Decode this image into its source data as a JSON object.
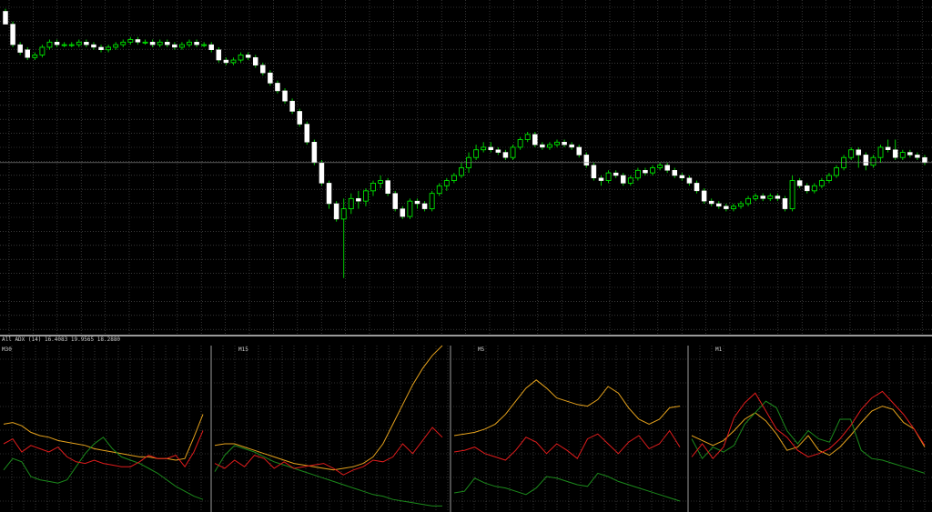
{
  "indicator_header": "All ADX (14) 16.4083 19.9565 18.2880",
  "colors": {
    "background": "#000000",
    "grid": "#5a5a5a",
    "candle_bull_body": "#000000",
    "candle_bull_outline": "#00ff00",
    "candle_bear_body": "#ffffff",
    "wick": "#00c800",
    "separator": "#9a9a9a",
    "adx_line": "#e6a21c",
    "plus_di_line": "#1c8a1c",
    "minus_di_line": "#e01c1c"
  },
  "chart_data": [
    {
      "type": "candlestick",
      "title": "",
      "price_axis": "none",
      "grid": true,
      "ylim": [
        0,
        100
      ],
      "candles": [
        [
          97,
          92,
          98,
          92
        ],
        [
          92,
          84,
          93,
          83
        ],
        [
          84,
          81,
          85,
          80
        ],
        [
          82,
          79,
          83,
          78
        ],
        [
          79,
          80,
          81,
          78
        ],
        [
          80,
          83,
          84,
          79
        ],
        [
          83,
          85,
          86,
          82
        ],
        [
          85,
          84,
          86,
          83
        ],
        [
          84,
          84,
          85,
          83
        ],
        [
          84,
          84,
          85,
          83
        ],
        [
          84,
          85,
          86,
          83
        ],
        [
          85,
          84,
          86,
          83
        ],
        [
          84,
          83,
          85,
          82
        ],
        [
          83,
          82,
          84,
          81
        ],
        [
          82,
          83,
          84,
          81
        ],
        [
          83,
          84,
          85,
          82
        ],
        [
          84,
          85,
          86,
          83
        ],
        [
          85,
          86,
          87,
          84
        ],
        [
          86,
          85,
          87,
          84
        ],
        [
          85,
          85,
          86,
          84
        ],
        [
          85,
          84,
          86,
          83
        ],
        [
          84,
          85,
          86,
          83
        ],
        [
          85,
          84,
          86,
          83
        ],
        [
          84,
          83,
          85,
          82
        ],
        [
          83,
          84,
          85,
          82
        ],
        [
          84,
          85,
          86,
          83
        ],
        [
          85,
          84,
          86,
          83
        ],
        [
          84,
          84,
          85,
          83
        ],
        [
          84,
          82,
          85,
          81
        ],
        [
          82,
          78,
          83,
          77
        ],
        [
          78,
          77,
          79,
          76
        ],
        [
          77,
          78,
          79,
          76
        ],
        [
          78,
          80,
          81,
          77
        ],
        [
          80,
          79,
          81,
          78
        ],
        [
          79,
          76,
          80,
          75
        ],
        [
          76,
          73,
          77,
          72
        ],
        [
          73,
          69,
          74,
          68
        ],
        [
          69,
          66,
          70,
          65
        ],
        [
          66,
          62,
          67,
          61
        ],
        [
          62,
          58,
          63,
          57
        ],
        [
          58,
          53,
          59,
          52
        ],
        [
          53,
          46,
          54,
          45
        ],
        [
          46,
          38,
          47,
          37
        ],
        [
          38,
          30,
          39,
          29
        ],
        [
          30,
          22,
          31,
          20
        ],
        [
          22,
          16,
          23,
          15
        ],
        [
          16,
          20,
          24,
          -7
        ],
        [
          20,
          24,
          26,
          18
        ],
        [
          24,
          23,
          27,
          20
        ],
        [
          23,
          27,
          28,
          21
        ],
        [
          27,
          30,
          31,
          25
        ],
        [
          30,
          31,
          33,
          28
        ],
        [
          31,
          26,
          32,
          25
        ],
        [
          26,
          20,
          27,
          19
        ],
        [
          20,
          17,
          21,
          16
        ],
        [
          17,
          23,
          24,
          16
        ],
        [
          23,
          22,
          24,
          20
        ],
        [
          22,
          20,
          23,
          19
        ],
        [
          20,
          26,
          27,
          19
        ],
        [
          26,
          29,
          30,
          25
        ],
        [
          29,
          31,
          32,
          27
        ],
        [
          31,
          33,
          34,
          30
        ],
        [
          33,
          36,
          38,
          32
        ],
        [
          36,
          40,
          42,
          34
        ],
        [
          40,
          43,
          45,
          39
        ],
        [
          43,
          44,
          46,
          42
        ],
        [
          44,
          43,
          46,
          42
        ],
        [
          43,
          42,
          44,
          41
        ],
        [
          42,
          40,
          43,
          39
        ],
        [
          40,
          44,
          45,
          39
        ],
        [
          44,
          47,
          48,
          43
        ],
        [
          47,
          49,
          50,
          46
        ],
        [
          49,
          45,
          50,
          44
        ],
        [
          45,
          44,
          46,
          43
        ],
        [
          44,
          45,
          46,
          43
        ],
        [
          45,
          46,
          47,
          44
        ],
        [
          46,
          45,
          47,
          44
        ],
        [
          45,
          44,
          46,
          43
        ],
        [
          44,
          41,
          45,
          40
        ],
        [
          41,
          37,
          42,
          36
        ],
        [
          37,
          32,
          38,
          31
        ],
        [
          32,
          31,
          33,
          29
        ],
        [
          31,
          34,
          35,
          30
        ],
        [
          34,
          33,
          35,
          32
        ],
        [
          33,
          30,
          34,
          29
        ],
        [
          30,
          32,
          33,
          29
        ],
        [
          32,
          35,
          36,
          31
        ],
        [
          35,
          34,
          36,
          33
        ],
        [
          34,
          36,
          37,
          33
        ],
        [
          36,
          37,
          38,
          35
        ],
        [
          37,
          35,
          38,
          34
        ],
        [
          35,
          33,
          36,
          32
        ],
        [
          33,
          32,
          34,
          31
        ],
        [
          32,
          30,
          33,
          29
        ],
        [
          30,
          27,
          31,
          26
        ],
        [
          27,
          23,
          28,
          22
        ],
        [
          23,
          22,
          24,
          21
        ],
        [
          22,
          21,
          23,
          20
        ],
        [
          21,
          20,
          22,
          19
        ],
        [
          20,
          21,
          22,
          19
        ],
        [
          21,
          22,
          23,
          20
        ],
        [
          22,
          24,
          25,
          21
        ],
        [
          24,
          25,
          26,
          23
        ],
        [
          25,
          24,
          26,
          23
        ],
        [
          24,
          25,
          26,
          23
        ],
        [
          25,
          24,
          26,
          23
        ],
        [
          24,
          20,
          25,
          19
        ],
        [
          20,
          31,
          33,
          19
        ],
        [
          31,
          29,
          32,
          28
        ],
        [
          29,
          27,
          30,
          26
        ],
        [
          27,
          29,
          30,
          26
        ],
        [
          29,
          31,
          32,
          28
        ],
        [
          31,
          33,
          34,
          30
        ],
        [
          33,
          36,
          37,
          32
        ],
        [
          36,
          40,
          41,
          35
        ],
        [
          40,
          43,
          44,
          39
        ],
        [
          43,
          41,
          44,
          36
        ],
        [
          41,
          37,
          42,
          35
        ],
        [
          37,
          40,
          41,
          36
        ],
        [
          40,
          44,
          45,
          38
        ],
        [
          44,
          43,
          47,
          42
        ],
        [
          43,
          40,
          47,
          39
        ],
        [
          40,
          42,
          43,
          39
        ],
        [
          42,
          41,
          43,
          40
        ],
        [
          41,
          40,
          42,
          39
        ],
        [
          40,
          38,
          41,
          37
        ]
      ]
    },
    {
      "type": "line",
      "title": "M30",
      "grid": true,
      "ylim": [
        0,
        100
      ],
      "series": [
        {
          "key": "adx",
          "values": [
            52,
            53,
            51,
            47,
            45,
            44,
            42,
            41,
            40,
            39,
            37,
            36,
            35,
            34,
            33,
            32,
            32,
            31,
            31,
            30,
            31,
            44,
            58
          ]
        },
        {
          "key": "plus_di",
          "values": [
            24,
            31,
            29,
            20,
            18,
            17,
            16,
            18,
            26,
            34,
            40,
            44,
            37,
            32,
            30,
            28,
            25,
            22,
            18,
            14,
            11,
            8,
            6
          ]
        },
        {
          "key": "minus_di",
          "values": [
            40,
            43,
            35,
            39,
            37,
            35,
            38,
            32,
            29,
            28,
            30,
            28,
            27,
            26,
            26,
            29,
            33,
            31,
            31,
            33,
            26,
            35,
            48
          ]
        }
      ]
    },
    {
      "type": "line",
      "title": "M15",
      "grid": true,
      "ylim": [
        0,
        100
      ],
      "series": [
        {
          "key": "adx",
          "values": [
            39,
            40,
            40,
            38,
            36,
            34,
            32,
            30,
            28,
            27,
            26,
            25,
            24,
            25,
            26,
            28,
            32,
            40,
            52,
            64,
            76,
            86,
            94,
            100
          ]
        },
        {
          "key": "plus_di",
          "values": [
            23,
            33,
            39,
            37,
            35,
            32,
            29,
            27,
            25,
            23,
            21,
            19,
            17,
            15,
            13,
            11,
            9,
            8,
            6,
            5,
            4,
            3,
            2,
            2
          ]
        },
        {
          "key": "minus_di",
          "values": [
            28,
            25,
            30,
            26,
            33,
            31,
            25,
            29,
            25,
            26,
            27,
            28,
            25,
            21,
            24,
            26,
            30,
            29,
            32,
            40,
            34,
            42,
            50,
            44
          ]
        }
      ]
    },
    {
      "type": "line",
      "title": "M5",
      "grid": true,
      "ylim": [
        0,
        100
      ],
      "series": [
        {
          "key": "adx",
          "values": [
            45,
            46,
            47,
            49,
            52,
            58,
            66,
            74,
            79,
            74,
            68,
            66,
            64,
            63,
            67,
            75,
            71,
            62,
            55,
            52,
            55,
            62,
            63
          ]
        },
        {
          "key": "plus_di",
          "values": [
            10,
            11,
            19,
            16,
            14,
            13,
            11,
            9,
            13,
            20,
            19,
            17,
            15,
            14,
            22,
            20,
            17,
            15,
            13,
            11,
            9,
            7,
            5
          ]
        },
        {
          "key": "minus_di",
          "values": [
            35,
            36,
            38,
            34,
            32,
            30,
            36,
            44,
            41,
            34,
            40,
            36,
            31,
            43,
            46,
            40,
            34,
            41,
            45,
            37,
            40,
            48,
            38
          ]
        }
      ]
    },
    {
      "type": "line",
      "title": "M1",
      "grid": true,
      "ylim": [
        0,
        100
      ],
      "series": [
        {
          "key": "adx",
          "values": [
            45,
            42,
            39,
            42,
            48,
            55,
            59,
            54,
            46,
            36,
            38,
            45,
            36,
            33,
            38,
            45,
            53,
            60,
            63,
            61,
            53,
            49,
            38
          ]
        },
        {
          "key": "plus_di",
          "values": [
            43,
            31,
            38,
            35,
            39,
            52,
            59,
            66,
            62,
            48,
            40,
            48,
            43,
            41,
            55,
            55,
            36,
            31,
            30,
            28,
            26,
            24,
            22
          ]
        },
        {
          "key": "minus_di",
          "values": [
            32,
            40,
            31,
            38,
            56,
            65,
            71,
            60,
            49,
            44,
            36,
            32,
            34,
            37,
            43,
            51,
            61,
            68,
            72,
            65,
            58,
            49,
            39
          ]
        }
      ]
    }
  ]
}
